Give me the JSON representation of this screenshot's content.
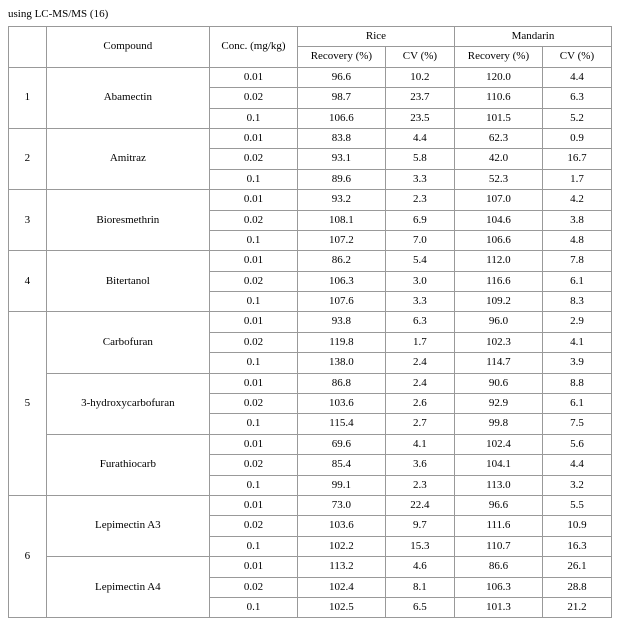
{
  "title": "using LC-MS/MS (16)",
  "table": {
    "headers": {
      "no": "",
      "compound": "Compound",
      "conc": "Conc. (mg/kg)",
      "rice": "Rice",
      "mandarin": "Mandarin",
      "recovery": "Recovery (%)",
      "cv": "CV (%)"
    },
    "rows": [
      {
        "no": "1",
        "compound": "Abamectin",
        "conc": "0.01",
        "r_rec": "96.6",
        "r_cv": "10.2",
        "m_rec": "120.0",
        "m_cv": "4.4"
      },
      {
        "no": "",
        "compound": "",
        "conc": "0.02",
        "r_rec": "98.7",
        "r_cv": "23.7",
        "m_rec": "110.6",
        "m_cv": "6.3"
      },
      {
        "no": "",
        "compound": "",
        "conc": "0.1",
        "r_rec": "106.6",
        "r_cv": "23.5",
        "m_rec": "101.5",
        "m_cv": "5.2"
      },
      {
        "no": "2",
        "compound": "Amitraz",
        "conc": "0.01",
        "r_rec": "83.8",
        "r_cv": "4.4",
        "m_rec": "62.3",
        "m_cv": "0.9"
      },
      {
        "no": "",
        "compound": "",
        "conc": "0.02",
        "r_rec": "93.1",
        "r_cv": "5.8",
        "m_rec": "42.0",
        "m_cv": "16.7"
      },
      {
        "no": "",
        "compound": "",
        "conc": "0.1",
        "r_rec": "89.6",
        "r_cv": "3.3",
        "m_rec": "52.3",
        "m_cv": "1.7"
      },
      {
        "no": "3",
        "compound": "Bioresmethrin",
        "conc": "0.01",
        "r_rec": "93.2",
        "r_cv": "2.3",
        "m_rec": "107.0",
        "m_cv": "4.2"
      },
      {
        "no": "",
        "compound": "",
        "conc": "0.02",
        "r_rec": "108.1",
        "r_cv": "6.9",
        "m_rec": "104.6",
        "m_cv": "3.8"
      },
      {
        "no": "",
        "compound": "",
        "conc": "0.1",
        "r_rec": "107.2",
        "r_cv": "7.0",
        "m_rec": "106.6",
        "m_cv": "4.8"
      },
      {
        "no": "4",
        "compound": "Bitertanol",
        "conc": "0.01",
        "r_rec": "86.2",
        "r_cv": "5.4",
        "m_rec": "112.0",
        "m_cv": "7.8"
      },
      {
        "no": "",
        "compound": "",
        "conc": "0.02",
        "r_rec": "106.3",
        "r_cv": "3.0",
        "m_rec": "116.6",
        "m_cv": "6.1"
      },
      {
        "no": "",
        "compound": "",
        "conc": "0.1",
        "r_rec": "107.6",
        "r_cv": "3.3",
        "m_rec": "109.2",
        "m_cv": "8.3"
      },
      {
        "no": "5",
        "compound": "Carbofuran",
        "conc": "0.01",
        "r_rec": "93.8",
        "r_cv": "6.3",
        "m_rec": "96.0",
        "m_cv": "2.9"
      },
      {
        "no": "",
        "compound": "",
        "conc": "0.02",
        "r_rec": "119.8",
        "r_cv": "1.7",
        "m_rec": "102.3",
        "m_cv": "4.1"
      },
      {
        "no": "",
        "compound": "",
        "conc": "0.1",
        "r_rec": "138.0",
        "r_cv": "2.4",
        "m_rec": "114.7",
        "m_cv": "3.9"
      },
      {
        "no": "",
        "compound": "3-hydroxycarbofuran",
        "conc": "0.01",
        "r_rec": "86.8",
        "r_cv": "2.4",
        "m_rec": "90.6",
        "m_cv": "8.8"
      },
      {
        "no": "",
        "compound": "",
        "conc": "0.02",
        "r_rec": "103.6",
        "r_cv": "2.6",
        "m_rec": "92.9",
        "m_cv": "6.1"
      },
      {
        "no": "",
        "compound": "",
        "conc": "0.1",
        "r_rec": "115.4",
        "r_cv": "2.7",
        "m_rec": "99.8",
        "m_cv": "7.5"
      },
      {
        "no": "",
        "compound": "Furathiocarb",
        "conc": "0.01",
        "r_rec": "69.6",
        "r_cv": "4.1",
        "m_rec": "102.4",
        "m_cv": "5.6"
      },
      {
        "no": "",
        "compound": "",
        "conc": "0.02",
        "r_rec": "85.4",
        "r_cv": "3.6",
        "m_rec": "104.1",
        "m_cv": "4.4"
      },
      {
        "no": "",
        "compound": "",
        "conc": "0.1",
        "r_rec": "99.1",
        "r_cv": "2.3",
        "m_rec": "113.0",
        "m_cv": "3.2"
      },
      {
        "no": "6",
        "compound": "Lepimectin A3",
        "conc": "0.01",
        "r_rec": "73.0",
        "r_cv": "22.4",
        "m_rec": "96.6",
        "m_cv": "5.5"
      },
      {
        "no": "",
        "compound": "",
        "conc": "0.02",
        "r_rec": "103.6",
        "r_cv": "9.7",
        "m_rec": "111.6",
        "m_cv": "10.9"
      },
      {
        "no": "",
        "compound": "",
        "conc": "0.1",
        "r_rec": "102.2",
        "r_cv": "15.3",
        "m_rec": "110.7",
        "m_cv": "16.3"
      },
      {
        "no": "",
        "compound": "Lepimectin A4",
        "conc": "0.01",
        "r_rec": "113.2",
        "r_cv": "4.6",
        "m_rec": "86.6",
        "m_cv": "26.1"
      },
      {
        "no": "",
        "compound": "",
        "conc": "0.02",
        "r_rec": "102.4",
        "r_cv": "8.1",
        "m_rec": "106.3",
        "m_cv": "28.8"
      },
      {
        "no": "",
        "compound": "",
        "conc": "0.1",
        "r_rec": "102.5",
        "r_cv": "6.5",
        "m_rec": "101.3",
        "m_cv": "21.2"
      }
    ]
  }
}
